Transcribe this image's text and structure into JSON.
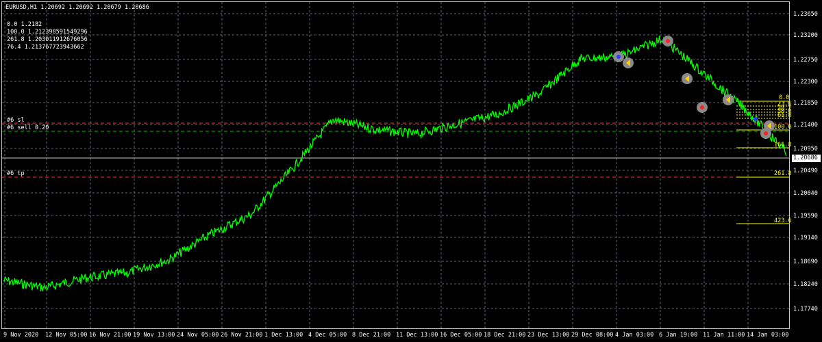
{
  "header": {
    "symbol_info": "EURUSD,H1  1.20692 1.20692 1.20679 1.20686"
  },
  "fibo_info": [
    "0.0 1.2182",
    "100.0 1.212398591549296",
    "261.8 1.203011912676056",
    "76.4 1.213767723943662"
  ],
  "order_labels": {
    "sl": "#6 sl",
    "sell": "#6 sell 0.20",
    "tp": "#6 tp"
  },
  "price_axis": [
    "1.23650",
    "1.23200",
    "1.22750",
    "1.22300",
    "1.21850",
    "1.21400",
    "1.20950",
    "1.20490",
    "1.20040",
    "1.19590",
    "1.19140",
    "1.18690",
    "1.18240",
    "1.17740"
  ],
  "current_price": "1.20686",
  "time_axis": [
    "9 Nov 2020",
    "12 Nov 05:00",
    "16 Nov 21:00",
    "19 Nov 13:00",
    "24 Nov 05:00",
    "26 Nov 21:00",
    "1 Dec 13:00",
    "4 Dec 05:00",
    "8 Dec 21:00",
    "11 Dec 13:00",
    "16 Dec 05:00",
    "18 Dec 21:00",
    "23 Dec 13:00",
    "29 Dec 08:00",
    "4 Jan 03:00",
    "6 Jan 19:00",
    "11 Jan 11:00",
    "14 Jan 03:00"
  ],
  "fibo_levels": {
    "l0": "0.0",
    "l23": "23.6",
    "l38": "38.2",
    "l50": "50.0",
    "l61": "61.8",
    "l100": "100.0",
    "l161": "161.8",
    "l261": "261.8",
    "l423": "423.6"
  },
  "colors": {
    "background": "#000000",
    "price_line": "#00ff00",
    "grid": "#5a6a78",
    "fibo": "#ffff00",
    "sl_tp": "#ff3030",
    "sell_line": "#00c000"
  },
  "chart_data": {
    "type": "line",
    "title": "EURUSD,H1",
    "ylim": [
      1.1774,
      1.2365
    ],
    "x": [
      "9 Nov 2020",
      "12 Nov 05:00",
      "16 Nov 21:00",
      "19 Nov 13:00",
      "24 Nov 05:00",
      "26 Nov 21:00",
      "1 Dec 13:00",
      "4 Dec 05:00",
      "8 Dec 21:00",
      "11 Dec 13:00",
      "16 Dec 05:00",
      "18 Dec 21:00",
      "23 Dec 13:00",
      "29 Dec 08:00",
      "4 Jan 03:00",
      "6 Jan 19:00",
      "11 Jan 11:00",
      "14 Jan 03:00"
    ],
    "series": [
      {
        "values": [
          1.183,
          1.1815,
          1.1835,
          1.1845,
          1.187,
          1.192,
          1.196,
          1.205,
          1.215,
          1.213,
          1.212,
          1.214,
          1.216,
          1.22,
          1.227,
          1.2275,
          1.231,
          1.224,
          1.217,
          1.2085
        ]
      }
    ],
    "grid": true
  }
}
